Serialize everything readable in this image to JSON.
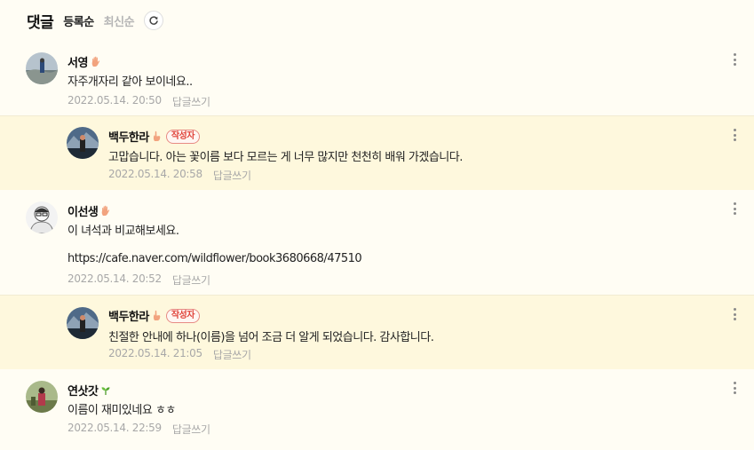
{
  "header": {
    "title": "댓글",
    "sort_options": [
      "등록순",
      "최신순"
    ],
    "active_sort": "등록순"
  },
  "comments": [
    {
      "nickname": "서영",
      "text": "자주개자리 같아 보이네요..",
      "date": "2022.05.14. 20:50",
      "reply_label": "답글쓰기",
      "is_reply": false
    },
    {
      "nickname": "백두한라",
      "badge": "작성자",
      "text": "고맙습니다. 아는 꽃이름 보다 모르는 게 너무 많지만 천천히 배워 가겠습니다.",
      "date": "2022.05.14. 20:58",
      "reply_label": "답글쓰기",
      "is_reply": true
    },
    {
      "nickname": "이선생",
      "text": "이 녀석과 비교해보세요.",
      "link": "https://cafe.naver.com/wildflower/book3680668/47510",
      "date": "2022.05.14. 20:52",
      "reply_label": "답글쓰기",
      "is_reply": false
    },
    {
      "nickname": "백두한라",
      "badge": "작성자",
      "text": "친절한 안내에 하나(이름)을 넘어 조금 더 알게 되었습니다. 감사합니다.",
      "date": "2022.05.14. 21:05",
      "reply_label": "답글쓰기",
      "is_reply": true
    },
    {
      "nickname": "연삿갓",
      "text": "이름이 재미있네요 ㅎㅎ",
      "date": "2022.05.14. 22:59",
      "reply_label": "답글쓰기",
      "is_reply": false
    }
  ],
  "colors": {
    "background": "#fffdf4",
    "reply_background": "#fef8dd",
    "badge_red": "#e0443b",
    "meta_gray": "#a8a8a8"
  },
  "icons": {
    "refresh": "refresh-icon",
    "more": "more-vertical-icon",
    "level_hand": "hand-level-icon",
    "level_finger": "finger-level-icon",
    "level_sprout": "sprout-level-icon"
  }
}
